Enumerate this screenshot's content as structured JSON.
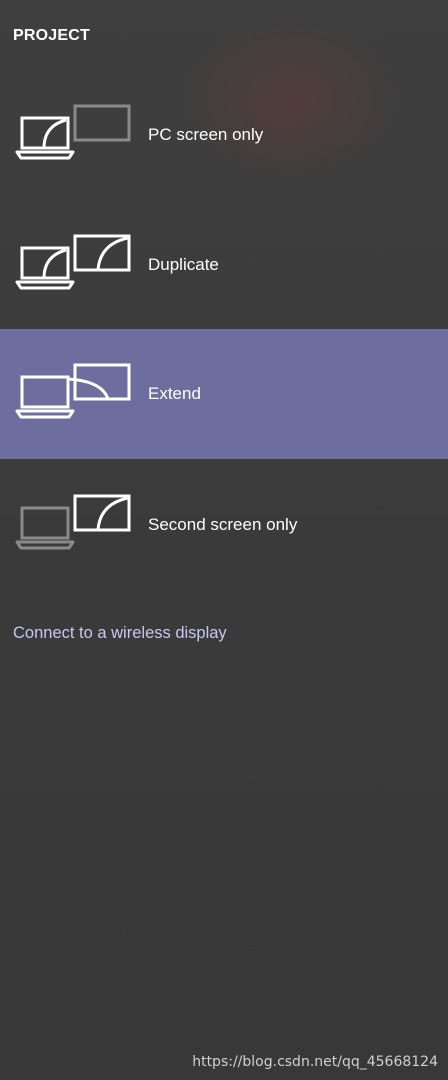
{
  "panel": {
    "title": "PROJECT"
  },
  "options": [
    {
      "label": "PC screen only",
      "icon": "pc-screen-only-icon",
      "selected": false
    },
    {
      "label": "Duplicate",
      "icon": "duplicate-icon",
      "selected": false
    },
    {
      "label": "Extend",
      "icon": "extend-icon",
      "selected": true
    },
    {
      "label": "Second screen only",
      "icon": "second-screen-only-icon",
      "selected": false
    }
  ],
  "wireless": {
    "label": "Connect to a wireless display"
  },
  "watermark": {
    "text": "https://blog.csdn.net/qq_45668124"
  },
  "colors": {
    "selected_background": "#6d6d9e",
    "link": "#c9c7f0",
    "icon_active": "#ffffff",
    "icon_dim": "#8a8a8a"
  }
}
